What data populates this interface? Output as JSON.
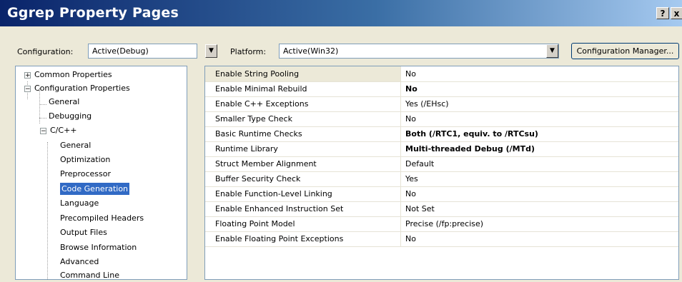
{
  "window": {
    "title": "Ggrep Property Pages",
    "help_label": "?",
    "close_label": "x"
  },
  "toolbar": {
    "configuration_label": "Configuration:",
    "configuration_value": "Active(Debug)",
    "platform_label": "Platform:",
    "platform_value": "Active(Win32)",
    "config_manager_label": "Configuration Manager..."
  },
  "tree": {
    "items": [
      {
        "label": "Common Properties",
        "expander": "+"
      },
      {
        "label": "Configuration Properties",
        "expander": "-"
      },
      {
        "label": "General"
      },
      {
        "label": "Debugging"
      },
      {
        "label": "C/C++",
        "expander": "-"
      },
      {
        "label": "General"
      },
      {
        "label": "Optimization"
      },
      {
        "label": "Preprocessor"
      },
      {
        "label": "Code Generation",
        "selected": true
      },
      {
        "label": "Language"
      },
      {
        "label": "Precompiled Headers"
      },
      {
        "label": "Output Files"
      },
      {
        "label": "Browse Information"
      },
      {
        "label": "Advanced"
      },
      {
        "label": "Command Line"
      }
    ]
  },
  "properties": {
    "rows": [
      {
        "name": "Enable String Pooling",
        "value": "No",
        "bold": false
      },
      {
        "name": "Enable Minimal Rebuild",
        "value": "No",
        "bold": true
      },
      {
        "name": "Enable C++ Exceptions",
        "value": "Yes (/EHsc)",
        "bold": false
      },
      {
        "name": "Smaller Type Check",
        "value": "No",
        "bold": false
      },
      {
        "name": "Basic Runtime Checks",
        "value": "Both (/RTC1, equiv. to /RTCsu)",
        "bold": true
      },
      {
        "name": "Runtime Library",
        "value": "Multi-threaded Debug (/MTd)",
        "bold": true
      },
      {
        "name": "Struct Member Alignment",
        "value": "Default",
        "bold": false
      },
      {
        "name": "Buffer Security Check",
        "value": "Yes",
        "bold": false
      },
      {
        "name": "Enable Function-Level Linking",
        "value": "No",
        "bold": false
      },
      {
        "name": "Enable Enhanced Instruction Set",
        "value": "Not Set",
        "bold": false
      },
      {
        "name": "Floating Point Model",
        "value": "Precise (/fp:precise)",
        "bold": false
      },
      {
        "name": "Enable Floating Point Exceptions",
        "value": "No",
        "bold": false
      }
    ]
  }
}
